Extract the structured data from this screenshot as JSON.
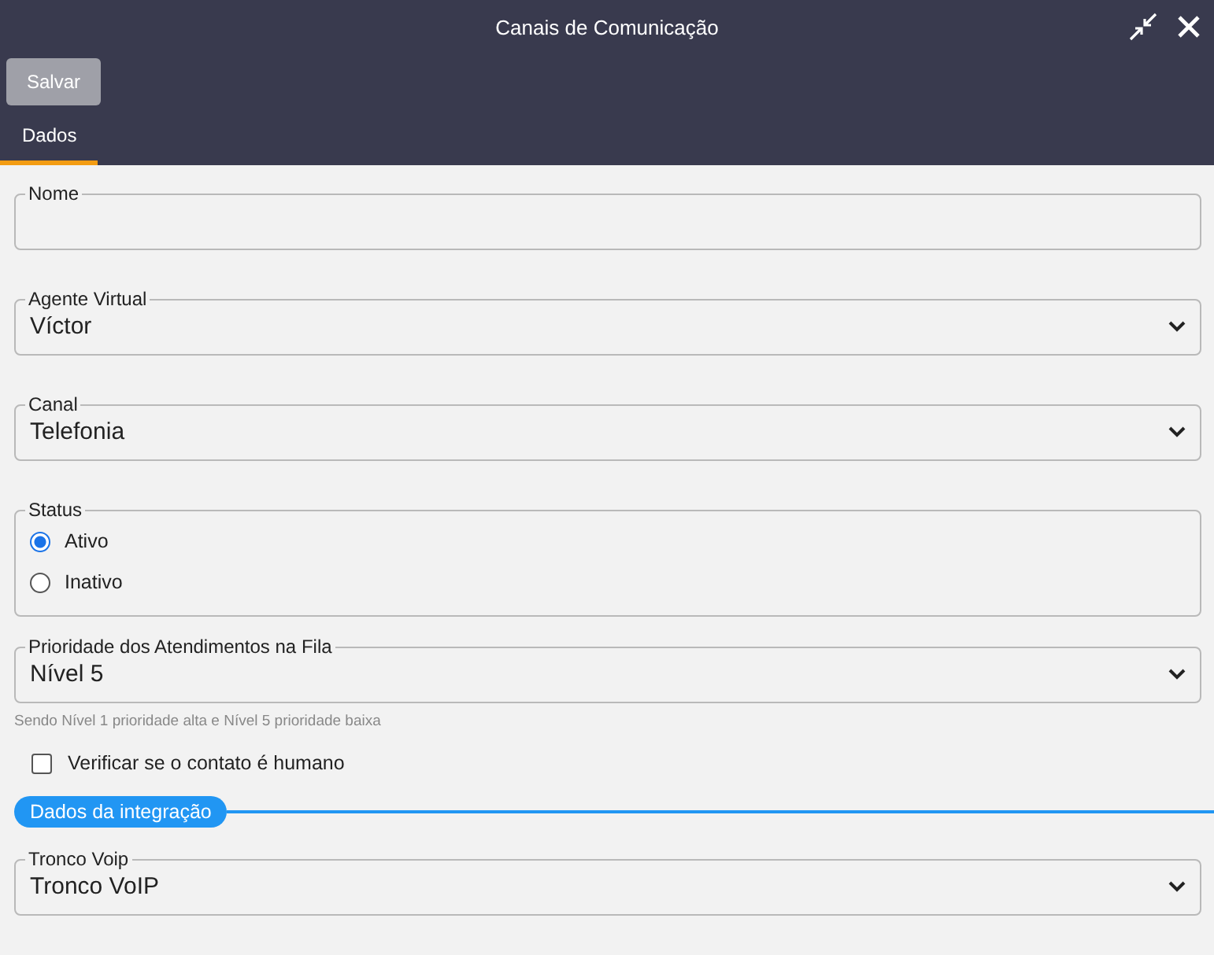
{
  "window": {
    "title": "Canais de Comunicação"
  },
  "toolbar": {
    "buttons": [
      {
        "label": "Salvar",
        "disabled": true
      }
    ]
  },
  "tabs": [
    {
      "label": "Dados",
      "selected": true
    }
  ],
  "fields": [
    {
      "kind": "text",
      "label": "Nome"
    },
    {
      "kind": "select",
      "label": "Agente Virtual",
      "value": "Víctor"
    },
    {
      "kind": "select",
      "label": "Canal",
      "value": "Telefonia"
    },
    {
      "kind": "radio",
      "label": "Status",
      "options": [
        {
          "label": "Ativo",
          "selected": true
        },
        {
          "label": "Inativo",
          "selected": false
        }
      ]
    },
    {
      "kind": "select",
      "label": "Prioridade dos Atendimentos na Fila",
      "value": "Nível 5",
      "hint": "Sendo Nível 1 prioridade alta e Nível 5 prioridade baixa"
    },
    {
      "kind": "checkbox",
      "label": "Verificar se o contato é humano",
      "checked": false
    },
    {
      "kind": "section",
      "label": "Dados da integração"
    },
    {
      "kind": "select",
      "label": "Tronco Voip",
      "value": "Tronco VoIP"
    }
  ]
}
